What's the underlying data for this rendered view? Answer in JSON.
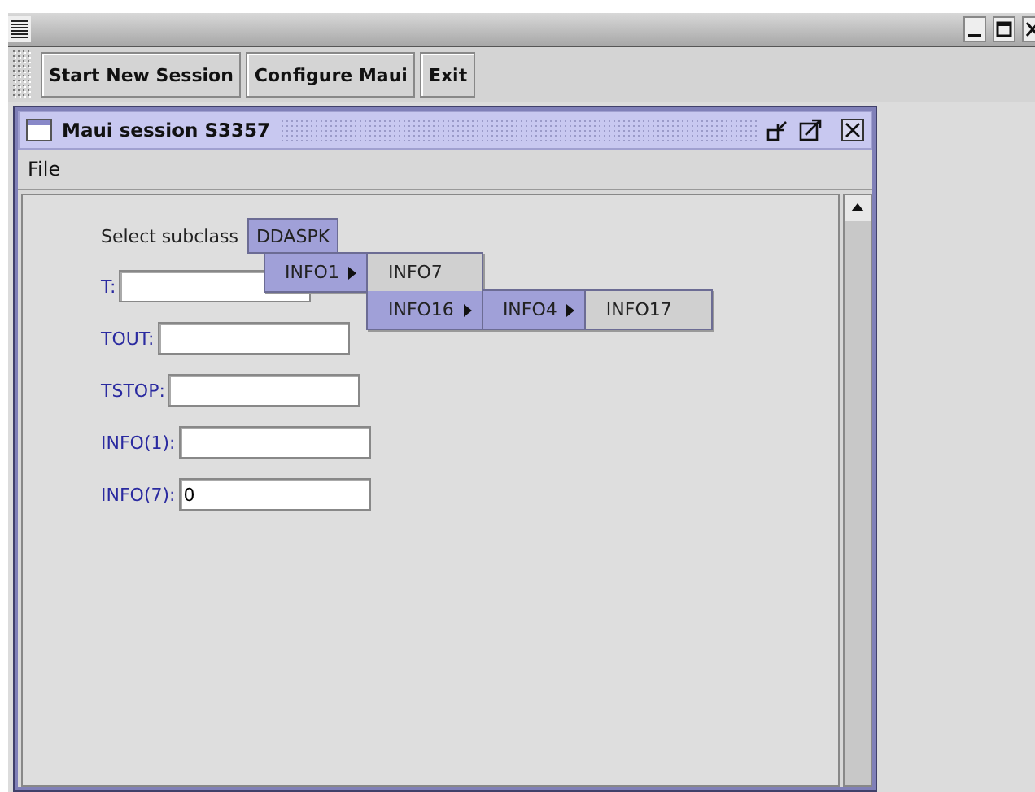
{
  "toolbar": {
    "buttons": [
      "Start New Session",
      "Configure Maui",
      "Exit"
    ]
  },
  "session_window": {
    "title": "Maui session S3357",
    "menu": [
      "File"
    ],
    "subclass_label": "Select subclass",
    "subclass_button": "DDASPK",
    "fields": [
      {
        "label": "T:"
      },
      {
        "label": "TOUT:"
      },
      {
        "label": "TSTOP:"
      },
      {
        "label": "INFO(1):"
      },
      {
        "label": "INFO(7):",
        "value": "0"
      }
    ]
  },
  "popup_menus": [
    [
      {
        "label": "INFO1",
        "submenu": true,
        "selected": true
      }
    ],
    [
      {
        "label": "INFO7",
        "submenu": false,
        "selected": false
      },
      {
        "label": "INFO16",
        "submenu": true,
        "selected": true
      }
    ],
    [
      {
        "label": "INFO4",
        "submenu": true,
        "selected": true
      }
    ],
    [
      {
        "label": "INFO17",
        "submenu": false,
        "selected": false
      }
    ]
  ]
}
